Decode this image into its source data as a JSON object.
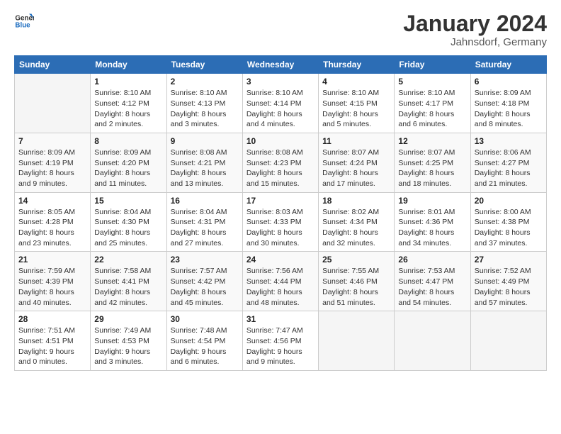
{
  "header": {
    "logo_general": "General",
    "logo_blue": "Blue",
    "title": "January 2024",
    "subtitle": "Jahnsdorf, Germany"
  },
  "calendar": {
    "days_of_week": [
      "Sunday",
      "Monday",
      "Tuesday",
      "Wednesday",
      "Thursday",
      "Friday",
      "Saturday"
    ],
    "weeks": [
      [
        {
          "day": "",
          "info": ""
        },
        {
          "day": "1",
          "info": "Sunrise: 8:10 AM\nSunset: 4:12 PM\nDaylight: 8 hours\nand 2 minutes."
        },
        {
          "day": "2",
          "info": "Sunrise: 8:10 AM\nSunset: 4:13 PM\nDaylight: 8 hours\nand 3 minutes."
        },
        {
          "day": "3",
          "info": "Sunrise: 8:10 AM\nSunset: 4:14 PM\nDaylight: 8 hours\nand 4 minutes."
        },
        {
          "day": "4",
          "info": "Sunrise: 8:10 AM\nSunset: 4:15 PM\nDaylight: 8 hours\nand 5 minutes."
        },
        {
          "day": "5",
          "info": "Sunrise: 8:10 AM\nSunset: 4:17 PM\nDaylight: 8 hours\nand 6 minutes."
        },
        {
          "day": "6",
          "info": "Sunrise: 8:09 AM\nSunset: 4:18 PM\nDaylight: 8 hours\nand 8 minutes."
        }
      ],
      [
        {
          "day": "7",
          "info": "Sunrise: 8:09 AM\nSunset: 4:19 PM\nDaylight: 8 hours\nand 9 minutes."
        },
        {
          "day": "8",
          "info": "Sunrise: 8:09 AM\nSunset: 4:20 PM\nDaylight: 8 hours\nand 11 minutes."
        },
        {
          "day": "9",
          "info": "Sunrise: 8:08 AM\nSunset: 4:21 PM\nDaylight: 8 hours\nand 13 minutes."
        },
        {
          "day": "10",
          "info": "Sunrise: 8:08 AM\nSunset: 4:23 PM\nDaylight: 8 hours\nand 15 minutes."
        },
        {
          "day": "11",
          "info": "Sunrise: 8:07 AM\nSunset: 4:24 PM\nDaylight: 8 hours\nand 17 minutes."
        },
        {
          "day": "12",
          "info": "Sunrise: 8:07 AM\nSunset: 4:25 PM\nDaylight: 8 hours\nand 18 minutes."
        },
        {
          "day": "13",
          "info": "Sunrise: 8:06 AM\nSunset: 4:27 PM\nDaylight: 8 hours\nand 21 minutes."
        }
      ],
      [
        {
          "day": "14",
          "info": "Sunrise: 8:05 AM\nSunset: 4:28 PM\nDaylight: 8 hours\nand 23 minutes."
        },
        {
          "day": "15",
          "info": "Sunrise: 8:04 AM\nSunset: 4:30 PM\nDaylight: 8 hours\nand 25 minutes."
        },
        {
          "day": "16",
          "info": "Sunrise: 8:04 AM\nSunset: 4:31 PM\nDaylight: 8 hours\nand 27 minutes."
        },
        {
          "day": "17",
          "info": "Sunrise: 8:03 AM\nSunset: 4:33 PM\nDaylight: 8 hours\nand 30 minutes."
        },
        {
          "day": "18",
          "info": "Sunrise: 8:02 AM\nSunset: 4:34 PM\nDaylight: 8 hours\nand 32 minutes."
        },
        {
          "day": "19",
          "info": "Sunrise: 8:01 AM\nSunset: 4:36 PM\nDaylight: 8 hours\nand 34 minutes."
        },
        {
          "day": "20",
          "info": "Sunrise: 8:00 AM\nSunset: 4:38 PM\nDaylight: 8 hours\nand 37 minutes."
        }
      ],
      [
        {
          "day": "21",
          "info": "Sunrise: 7:59 AM\nSunset: 4:39 PM\nDaylight: 8 hours\nand 40 minutes."
        },
        {
          "day": "22",
          "info": "Sunrise: 7:58 AM\nSunset: 4:41 PM\nDaylight: 8 hours\nand 42 minutes."
        },
        {
          "day": "23",
          "info": "Sunrise: 7:57 AM\nSunset: 4:42 PM\nDaylight: 8 hours\nand 45 minutes."
        },
        {
          "day": "24",
          "info": "Sunrise: 7:56 AM\nSunset: 4:44 PM\nDaylight: 8 hours\nand 48 minutes."
        },
        {
          "day": "25",
          "info": "Sunrise: 7:55 AM\nSunset: 4:46 PM\nDaylight: 8 hours\nand 51 minutes."
        },
        {
          "day": "26",
          "info": "Sunrise: 7:53 AM\nSunset: 4:47 PM\nDaylight: 8 hours\nand 54 minutes."
        },
        {
          "day": "27",
          "info": "Sunrise: 7:52 AM\nSunset: 4:49 PM\nDaylight: 8 hours\nand 57 minutes."
        }
      ],
      [
        {
          "day": "28",
          "info": "Sunrise: 7:51 AM\nSunset: 4:51 PM\nDaylight: 9 hours\nand 0 minutes."
        },
        {
          "day": "29",
          "info": "Sunrise: 7:49 AM\nSunset: 4:53 PM\nDaylight: 9 hours\nand 3 minutes."
        },
        {
          "day": "30",
          "info": "Sunrise: 7:48 AM\nSunset: 4:54 PM\nDaylight: 9 hours\nand 6 minutes."
        },
        {
          "day": "31",
          "info": "Sunrise: 7:47 AM\nSunset: 4:56 PM\nDaylight: 9 hours\nand 9 minutes."
        },
        {
          "day": "",
          "info": ""
        },
        {
          "day": "",
          "info": ""
        },
        {
          "day": "",
          "info": ""
        }
      ]
    ]
  }
}
